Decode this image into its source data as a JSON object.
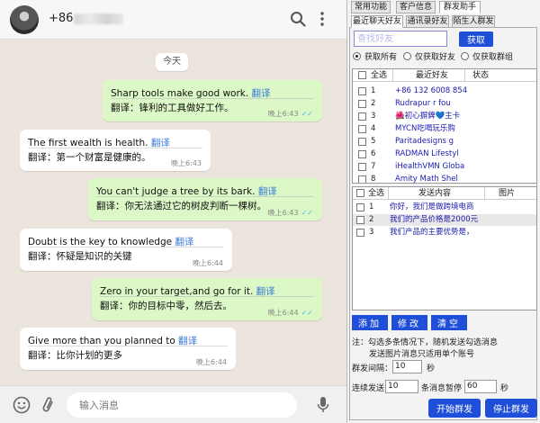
{
  "chat": {
    "contact_phone": "+86",
    "date_label": "今天",
    "input_placeholder": "输入消息",
    "messages": [
      {
        "original": "Sharp tools make good work.",
        "link": "翻译",
        "translation": "翻译：锋利的工具做好工作。",
        "time": "晚上6:43",
        "ticks": "✓✓"
      },
      {
        "original": "The first wealth is health.",
        "link": "翻译",
        "translation": "翻译：第一个财富是健康的。",
        "time": "晚上6:43",
        "ticks": ""
      },
      {
        "original": "You can't judge a tree by its bark.",
        "link": "翻译",
        "translation": "翻译：你无法通过它的树皮判断一棵树。",
        "time": "晚上6:43",
        "ticks": "✓✓"
      },
      {
        "original": "Doubt is the key to knowledge",
        "link": "翻译",
        "translation": "翻译：怀疑是知识的关键",
        "time": "晚上6:44",
        "ticks": ""
      },
      {
        "original": "Zero in your target,and go for it.",
        "link": "翻译",
        "translation": "翻译：你的目标中零，然后去。",
        "time": "晚上6:44",
        "ticks": "✓✓"
      },
      {
        "original": "Give more than you planned to",
        "link": "翻译",
        "translation": "翻译：比你计划的更多",
        "time": "晚上6:44",
        "ticks": ""
      }
    ]
  },
  "panel": {
    "top_tabs": [
      "常用功能",
      "客户信息",
      "群发助手"
    ],
    "sub_tabs": [
      "最近聊天好友",
      "通讯录好友",
      "陌生人群发"
    ],
    "search_placeholder": "查找好友",
    "fetch_button": "获取",
    "radios": [
      "获取所有",
      "仅获取好友",
      "仅获取群组"
    ],
    "friends_header": {
      "select_all": "全选",
      "col_friend": "最近好友",
      "col_status": "状态"
    },
    "friends": [
      {
        "num": "1",
        "name": "+86 132 6008 854"
      },
      {
        "num": "2",
        "name": "Rudrapur r fou"
      },
      {
        "num": "3",
        "name": "🌺初心摒錍💙主卡"
      },
      {
        "num": "4",
        "name": "MYCN吃喝玩乐购"
      },
      {
        "num": "5",
        "name": "Paritadesigns g"
      },
      {
        "num": "6",
        "name": "RADMAN Lifestyl"
      },
      {
        "num": "7",
        "name": "iHealthVMN Globa"
      },
      {
        "num": "8",
        "name": "Amity Math Shel"
      }
    ],
    "content_header": {
      "select_all": "全选",
      "col_content": "发送内容",
      "col_image": "图片"
    },
    "contents": [
      {
        "num": "1",
        "text": "你好，我们是做跨境电商"
      },
      {
        "num": "2",
        "text": "我们的产品价格是2000元"
      },
      {
        "num": "3",
        "text": "我们产品的主要优势是，"
      }
    ],
    "buttons": {
      "add": "添加",
      "edit": "修改",
      "clear": "清空"
    },
    "note_line1": "注：勾选多条情况下，随机发送勾选消息",
    "note_line2": "发送图片消息只适用单个账号",
    "interval_label": "群发间隔：",
    "interval_value": "10",
    "interval_unit": "秒",
    "consecutive_label": "连续发送",
    "consecutive_value": "10",
    "pause_label": "条消息暂停",
    "pause_value": "60",
    "pause_unit": "秒",
    "start_button": "开始群发",
    "stop_button": "停止群发"
  }
}
